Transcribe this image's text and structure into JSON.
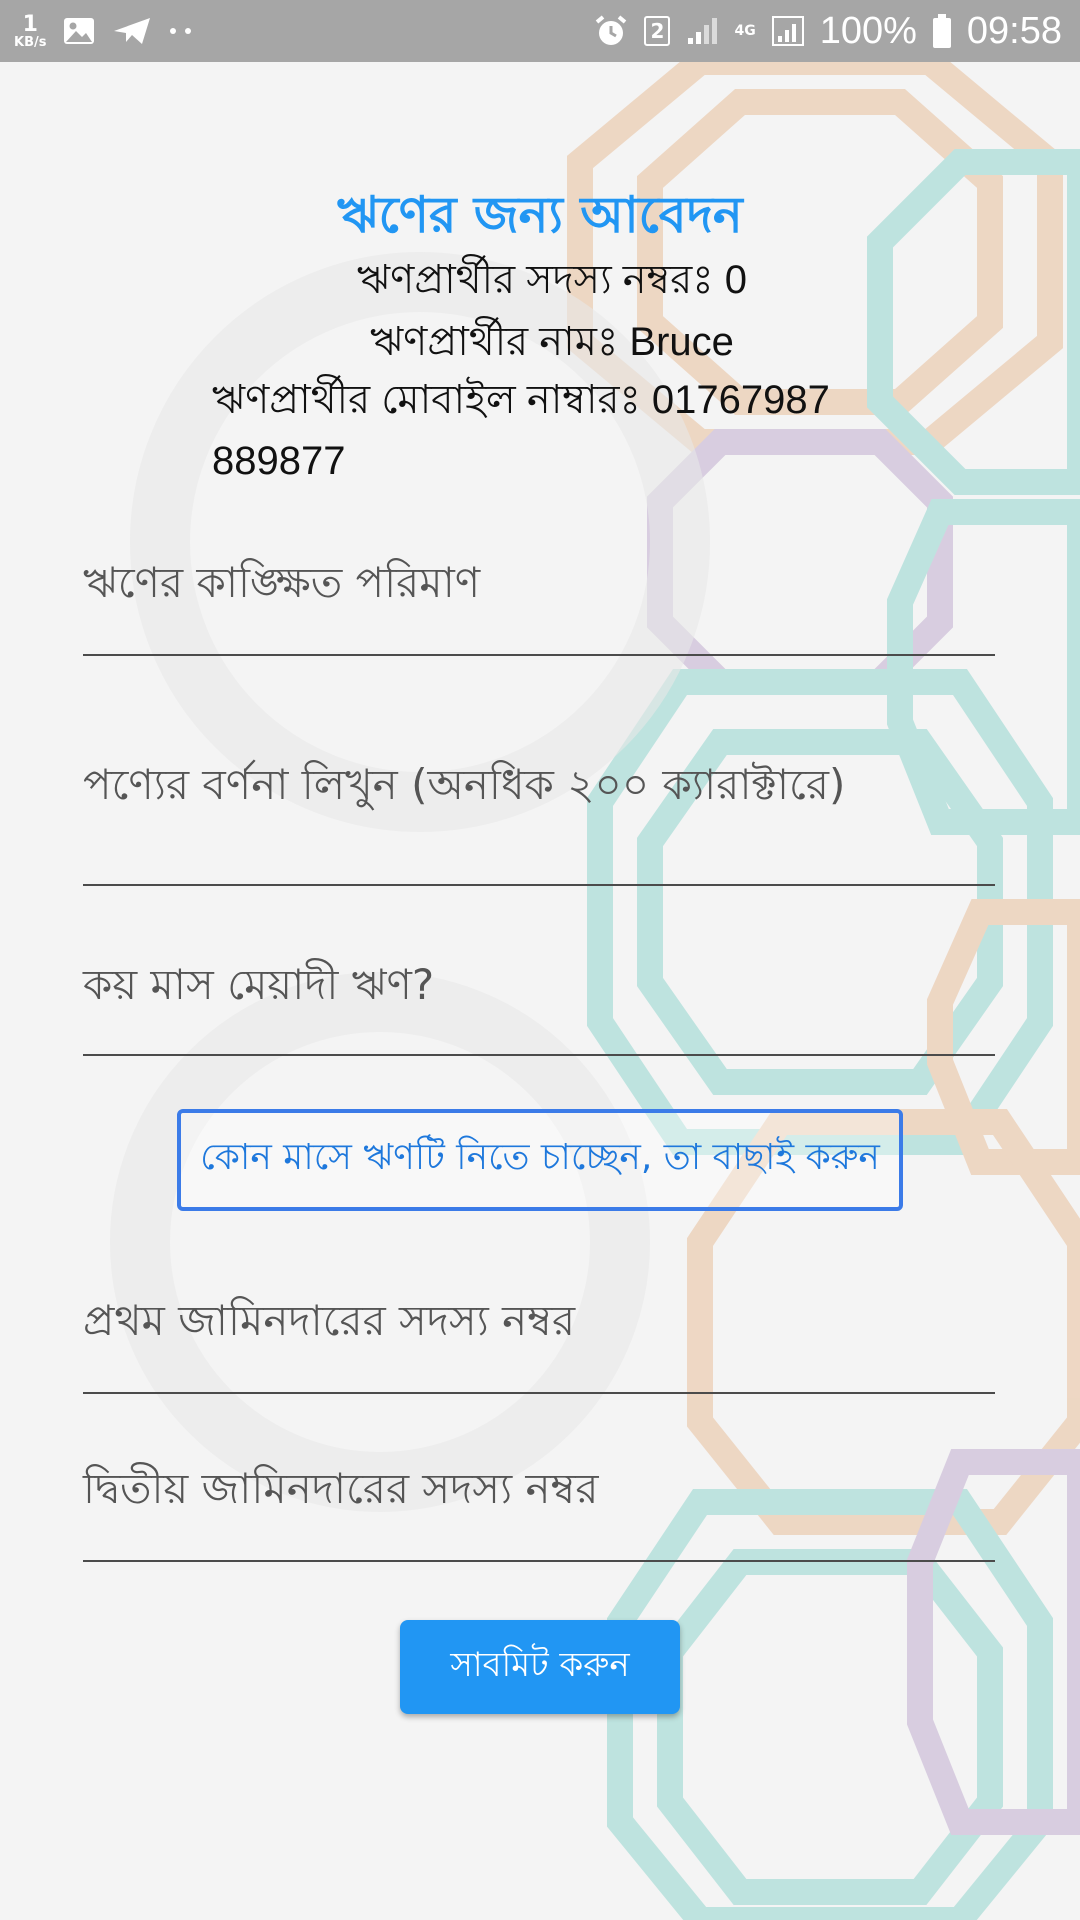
{
  "status_bar": {
    "net_speed_value": "1",
    "net_speed_unit": "KB/s",
    "sim_badge": "2",
    "network_type": "4G",
    "battery_percent": "100%",
    "time": "09:58",
    "icons": [
      "gallery-icon",
      "send-icon",
      "more-dots-icon",
      "alarm-icon",
      "signal-icon",
      "signal-icon",
      "battery-icon"
    ]
  },
  "form": {
    "title": "ঋণের জন্য আবেদন",
    "member_number_line": "ঋণপ্রার্থীর সদস্য নম্বরঃ 0",
    "name_line": "ঋণপ্রার্থীর নামঃ Bruce",
    "mobile_line": "ঋণপ্রার্থীর মোবাইল নাম্বারঃ 01767987 889877",
    "fields": {
      "amount_placeholder": "ঋণের কাঙ্ক্ষিত পরিমাণ",
      "description_placeholder": "পণ্যের বর্ণনা লিখুন (অনধিক ২০০ ক্যারাক্টারে)",
      "duration_placeholder": "কয় মাস মেয়াদী ঋণ?",
      "guarantor1_placeholder": "প্রথম জামিনদারের সদস্য নম্বর",
      "guarantor2_placeholder": "দ্বিতীয় জামিনদারের সদস্য নম্বর"
    },
    "month_button_label": "কোন মাসে ঋণটি নিতে চাচ্ছেন, তা বাছাই করুন",
    "submit_label": "সাবমিট করুন"
  },
  "colors": {
    "accent": "#2196f3",
    "month_button_border": "#3b7be8",
    "status_bar": "#a6a6a6"
  }
}
